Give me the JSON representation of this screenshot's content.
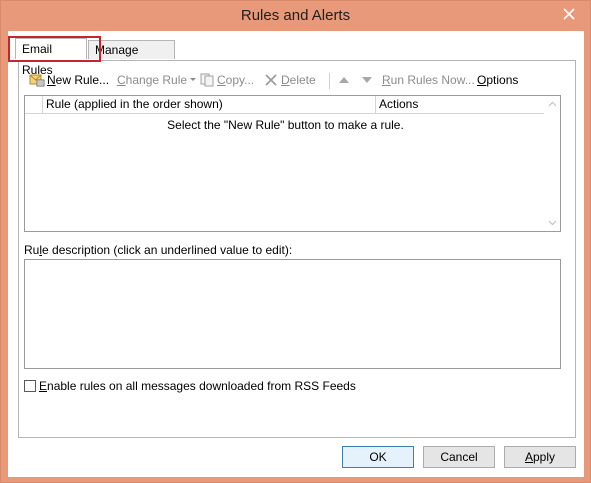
{
  "window": {
    "title": "Rules and Alerts"
  },
  "tabs": [
    {
      "label": "Email Rules",
      "active": true
    },
    {
      "label": "Manage Alerts",
      "active": false
    }
  ],
  "toolbar": {
    "new_rule_accel": "N",
    "new_rule_rest": "ew Rule...",
    "change_rule_accel": "C",
    "change_rule_rest": "hange Rule",
    "copy_accel": "C",
    "copy_rest": "opy...",
    "delete_accel": "D",
    "delete_rest": "elete",
    "run_rules_accel": "R",
    "run_rules_rest": "un Rules Now...",
    "options_accel": "O",
    "options_rest": "ptions"
  },
  "rules_list": {
    "columns": [
      "Rule (applied in the order shown)",
      "Actions"
    ],
    "empty_message": "Select the \"New Rule\" button to make a rule."
  },
  "description": {
    "label_pre": "Ru",
    "label_accel": "l",
    "label_post": "e description (click an underlined value to edit):"
  },
  "rss_checkbox": {
    "accel": "E",
    "rest": "nable rules on all messages downloaded from RSS Feeds",
    "checked": false
  },
  "buttons": {
    "ok": "OK",
    "cancel": "Cancel",
    "apply_accel": "A",
    "apply_rest": "pply"
  },
  "colors": {
    "frame": "#e8997a",
    "highlight": "#c4262e"
  }
}
